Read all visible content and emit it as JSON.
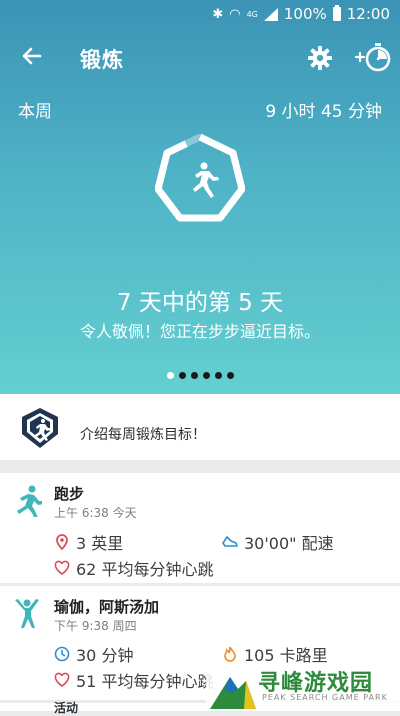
{
  "status_bar": {
    "battery": "100%",
    "time": "12:00",
    "network": "4G"
  },
  "app_bar": {
    "title": "锻炼"
  },
  "summary": {
    "week_label": "本周",
    "week_total": "9 小时 45 分钟",
    "day_progress": "7 天中的第 5 天",
    "motivation": "令人敬佩！您正在步步逼近目标。",
    "page_dots": 6,
    "active_dot": 0
  },
  "intro": {
    "text": "介绍每周锻炼目标！"
  },
  "activities": [
    {
      "name": "跑步",
      "time": "上午 6:38 今天",
      "icon": "running-icon",
      "stats": [
        {
          "icon": "location-pin-icon",
          "text": "3 英里",
          "color": "#e04b5a"
        },
        {
          "icon": "shoe-pace-icon",
          "text": "30'00\" 配速",
          "color": "#2c8fd6"
        },
        {
          "icon": "heart-icon",
          "text": "62 平均每分钟心跳",
          "color": "#e04b5a"
        }
      ]
    },
    {
      "name": "瑜伽，阿斯汤加",
      "time": "下午 9:38 周四",
      "icon": "yoga-icon",
      "stats": [
        {
          "icon": "clock-icon",
          "text": "30 分钟",
          "color": "#2c8fd6"
        },
        {
          "icon": "flame-icon",
          "text": "105 卡路里",
          "color": "#f08a24"
        },
        {
          "icon": "heart-icon",
          "text": "51 平均每分钟心跳",
          "color": "#e04b5a"
        }
      ]
    },
    {
      "name": "活动",
      "time": "",
      "icon": "activity-icon",
      "stats": []
    }
  ],
  "watermark": {
    "title": "寻峰游戏园",
    "subtitle": "PEAK SEARCH GAME PARK"
  },
  "colors": {
    "hero_top": "#3b93b5",
    "hero_bottom": "#64cfd0",
    "accent_teal": "#3fb6b9",
    "navy": "#1f3550"
  }
}
